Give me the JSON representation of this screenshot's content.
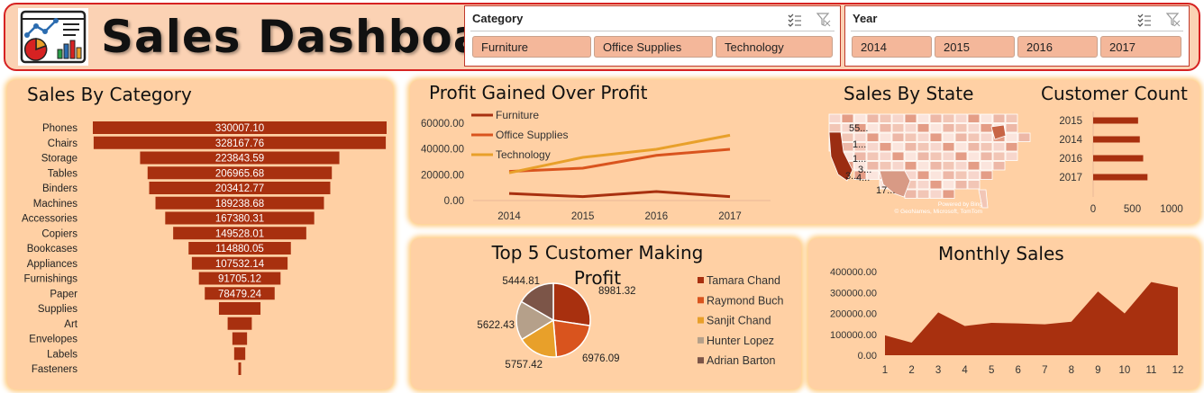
{
  "header": {
    "title": "Sales Dashboard",
    "logo_icon": "analytics-report-icon"
  },
  "slicers": {
    "category": {
      "title": "Category",
      "items": [
        "Furniture",
        "Office Supplies",
        "Technology"
      ]
    },
    "year": {
      "title": "Year",
      "items": [
        "2014",
        "2015",
        "2016",
        "2017"
      ]
    }
  },
  "colors": {
    "dark": "#a8300f",
    "mid": "#d9541e",
    "light": "#e8a02a",
    "panel": "#ffd0a4",
    "border": "#d62222"
  },
  "panels": {
    "sales_by_category": "Sales By Category",
    "profit": "Profit Gained Over Profit",
    "state": "Sales By State",
    "customer_count": "Customer Count",
    "top5": "Top 5 Customer Making Profit",
    "monthly": "Monthly Sales"
  },
  "map": {
    "labels": [
      "55...",
      "1...",
      "1...",
      "3...",
      "3...",
      "4...",
      "17..."
    ],
    "credit1": "Powered by Bing",
    "credit2": "© GeoNames, Microsoft, TomTom"
  },
  "chart_data": [
    {
      "type": "bar",
      "orientation": "horizontal",
      "title": "Sales By Category",
      "categories": [
        "Phones",
        "Chairs",
        "Storage",
        "Tables",
        "Binders",
        "Machines",
        "Accessories",
        "Copiers",
        "Bookcases",
        "Appliances",
        "Furnishings",
        "Paper",
        "Supplies",
        "Art",
        "Envelopes",
        "Labels",
        "Fasteners"
      ],
      "values": [
        330007.1,
        328167.76,
        223843.59,
        206965.68,
        203412.77,
        189238.68,
        167380.31,
        149528.01,
        114880.05,
        107532.14,
        91705.12,
        78479.24,
        46673.54,
        27118.79,
        16476.4,
        12486.31,
        3024.28
      ],
      "labels": [
        "330007.10",
        "328167.76",
        "223843.59",
        "206965.68",
        "203412.77",
        "189238.68",
        "167380.31",
        "149528.01",
        "114880.05",
        "107532.14",
        "91705.12",
        "78479.24",
        "",
        "",
        "",
        "",
        ""
      ]
    },
    {
      "type": "line",
      "title": "Profit Gained Over Profit",
      "x": [
        "2014",
        "2015",
        "2016",
        "2017"
      ],
      "ylim": [
        0,
        60000
      ],
      "yticks": [
        "0.00",
        "20000.00",
        "40000.00",
        "60000.00"
      ],
      "legend": "top-left",
      "series": [
        {
          "name": "Furniture",
          "values": [
            5457.73,
            3015.2,
            6959.95,
            3018.39
          ]
        },
        {
          "name": "Office Supplies",
          "values": [
            22593.42,
            25099.53,
            35061.23,
            39773.99
          ]
        },
        {
          "name": "Technology",
          "values": [
            21492.83,
            33503.87,
            39773.99,
            50684.26
          ]
        }
      ]
    },
    {
      "type": "bar",
      "orientation": "horizontal",
      "title": "Customer Count",
      "categories": [
        "2015",
        "2014",
        "2016",
        "2017"
      ],
      "values": [
        573,
        595,
        638,
        693
      ],
      "xlim": [
        0,
        1000
      ],
      "xticks": [
        "0",
        "500",
        "1000"
      ]
    },
    {
      "type": "pie",
      "title": "Top 5 Customer Making Profit",
      "series": [
        {
          "name": "Tamara Chand",
          "value": 8981.32
        },
        {
          "name": "Raymond Buch",
          "value": 6976.09
        },
        {
          "name": "Sanjit Chand",
          "value": 5757.42
        },
        {
          "name": "Hunter Lopez",
          "value": 5622.43
        },
        {
          "name": "Adrian Barton",
          "value": 5444.81
        }
      ],
      "labels": [
        "8981.32",
        "6976.09",
        "5757.42",
        "5622.43",
        "5444.81"
      ],
      "legend": "right"
    },
    {
      "type": "area",
      "title": "Monthly Sales",
      "x": [
        "1",
        "2",
        "3",
        "4",
        "5",
        "6",
        "7",
        "8",
        "9",
        "10",
        "11",
        "12"
      ],
      "values": [
        95000,
        60000,
        205000,
        140000,
        155000,
        152000,
        148000,
        160000,
        305000,
        200000,
        350000,
        325000
      ],
      "ylim": [
        0,
        400000
      ],
      "yticks": [
        "0.00",
        "100000.00",
        "200000.00",
        "300000.00",
        "400000.00"
      ]
    }
  ]
}
